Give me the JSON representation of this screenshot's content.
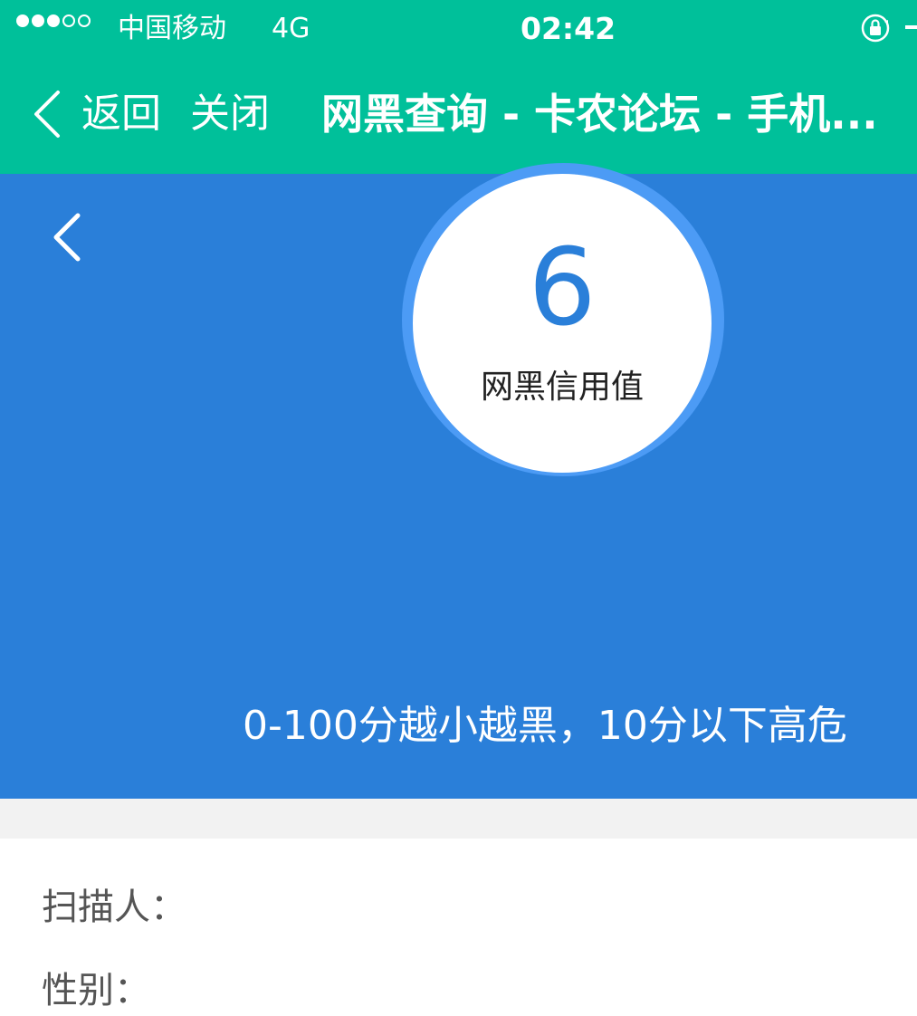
{
  "status_bar": {
    "signal_strength": 3,
    "signal_max": 5,
    "carrier": "中国移动",
    "network": "4G",
    "time": "02:42",
    "icons": [
      "orientation-lock-icon"
    ]
  },
  "nav_bar": {
    "back_label": "返回",
    "close_label": "关闭",
    "title": "网黑查询 - 卡农论坛 - 手机..."
  },
  "header": {
    "title": "网黑查询",
    "score": "6",
    "score_label": "网黑信用值",
    "hint": "0-100分越小越黑，10分以下高危"
  },
  "info": {
    "rows": [
      "扫描人：",
      "性别："
    ]
  },
  "colors": {
    "status_green": "#00c09a",
    "header_blue": "#2a7fd9",
    "ring_blue": "#4c9bf5"
  }
}
